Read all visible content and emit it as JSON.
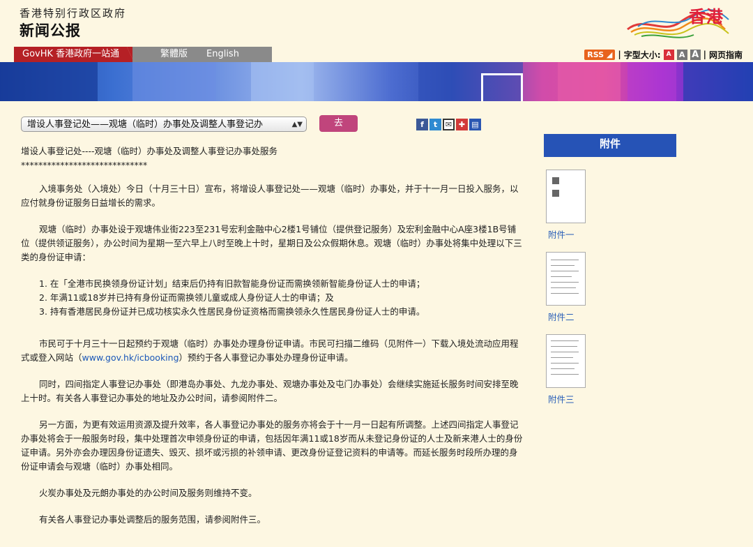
{
  "header": {
    "gov_name": "香港特别行政区政府",
    "page_name": "新闻公报",
    "logo_text": "香港"
  },
  "nav": {
    "govhk": "GovHK 香港政府一站通",
    "trad": "繁體版",
    "english": "English",
    "rss": "RSS",
    "font_size_label": "字型大小:",
    "font_a": "A",
    "guide": "网页指南"
  },
  "toolbar": {
    "select_value": "增设人事登记处——观塘（临时）办事处及调整人事登记办",
    "go_label": "去",
    "share_icons": [
      "facebook-icon",
      "twitter-icon",
      "email-icon",
      "bookmark-icon",
      "print-icon"
    ]
  },
  "article": {
    "title": "增设人事登记处----观塘（临时）办事处及调整人事登记办事处服务",
    "stars": "*****************************",
    "p1": "入境事务处（入境处）今日（十月三十日）宣布，将增设人事登记处——观塘（临时）办事处，并于十一月一日投入服务，以应付就身份证服务日益增长的需求。",
    "p2": "观塘（临时）办事处设于观塘伟业街223至231号宏利金融中心2楼1号铺位（提供登记服务）及宏利金融中心A座3楼1B号铺位（提供领证服务），办公时间为星期一至六早上八时至晚上十时，星期日及公众假期休息。观塘（临时）办事处将集中处理以下三类的身份证申请：",
    "list": [
      "1. 在「全港市民换领身份证计划」结束后仍持有旧款智能身份证而需换领新智能身份证人士的申请；",
      "2. 年满11或18岁并已持有身份证而需换领儿童或成人身份证人士的申请；及",
      "3. 持有香港居民身份证并已成功核实永久性居民身份证资格而需换领永久性居民身份证人士的申请。"
    ],
    "p3_before": "市民可于十月三十一日起预约于观塘（临时）办事处办理身份证申请。市民可扫描二维码（见附件一）下载入境处流动应用程式或登入网站（",
    "p3_link": "www.gov.hk/icbooking",
    "p3_after": "）预约于各人事登记办事处办理身份证申请。",
    "p4": "同时，四间指定人事登记办事处（即港岛办事处、九龙办事处、观塘办事处及屯门办事处）会继续实施延长服务时间安排至晚上十时。有关各人事登记办事处的地址及办公时间，请参阅附件二。",
    "p5": "另一方面，为更有效运用资源及提升效率，各人事登记办事处的服务亦将会于十一月一日起有所调整。上述四间指定人事登记办事处将会于一般服务时段，集中处理首次申领身份证的申请，包括因年满11或18岁而从未登记身份证的人士及新来港人士的身份证申请。另外亦会办理因身份证遗失、毁灭、损坏或污损的补领申请、更改身份证登记资料的申请等。而延长服务时段所办理的身份证申请会与观塘（临时）办事处相同。",
    "p6": "火炭办事处及元朗办事处的办公时间及服务则维持不变。",
    "p7": "有关各人事登记办事处调整后的服务范围，请参阅附件三。"
  },
  "sidebar": {
    "heading": "附件",
    "attachments": [
      "附件一",
      "附件二",
      "附件三"
    ]
  },
  "colors": {
    "background": "#fdf7e2",
    "govhk_red": "#b52025",
    "go_button": "#c0457c",
    "attachment_header": "#2653b6",
    "link": "#1a57b8"
  }
}
